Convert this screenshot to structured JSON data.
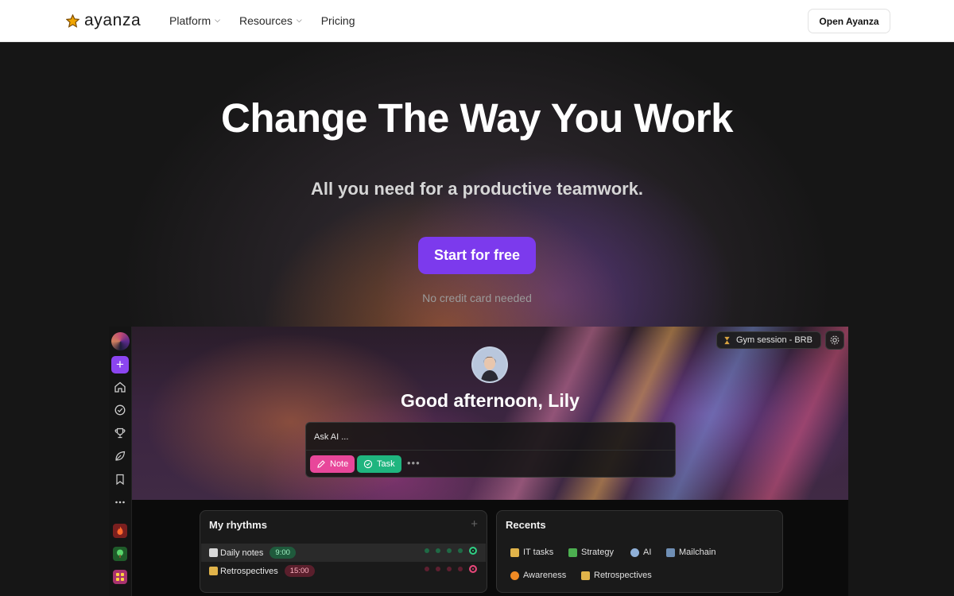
{
  "nav": {
    "brand": "ayanza",
    "links": [
      {
        "label": "Platform",
        "has_dropdown": true
      },
      {
        "label": "Resources",
        "has_dropdown": true
      },
      {
        "label": "Pricing",
        "has_dropdown": false
      }
    ],
    "open_button": "Open Ayanza"
  },
  "hero": {
    "title": "Change The Way You Work",
    "subtitle": "All you need for a productive teamwork.",
    "cta": "Start for free",
    "cta_note": "No credit card needed"
  },
  "app": {
    "status_pill": "Gym session - BRB",
    "greeting": "Good afternoon, Lily",
    "ask_placeholder": "Ask AI ...",
    "chips": {
      "note": "Note",
      "task": "Task"
    },
    "rhythms": {
      "title": "My rhythms",
      "items": [
        {
          "label": "Daily notes",
          "time": "9:00"
        },
        {
          "label": "Retrospectives",
          "time": "15:00"
        }
      ]
    },
    "recents": {
      "title": "Recents",
      "items": [
        "IT tasks",
        "Strategy",
        "AI",
        "Mailchain",
        "Awareness",
        "Retrospectives"
      ]
    }
  },
  "colors": {
    "accent": "#7c3aed",
    "note_chip": "#e8479a",
    "task_chip": "#1fb57f",
    "logo": "#f0a500"
  },
  "icons": {
    "sidebar": [
      "plus-icon",
      "home-icon",
      "check-circle-icon",
      "trophy-icon",
      "leaf-icon",
      "bookmark-icon",
      "more-icon"
    ]
  }
}
